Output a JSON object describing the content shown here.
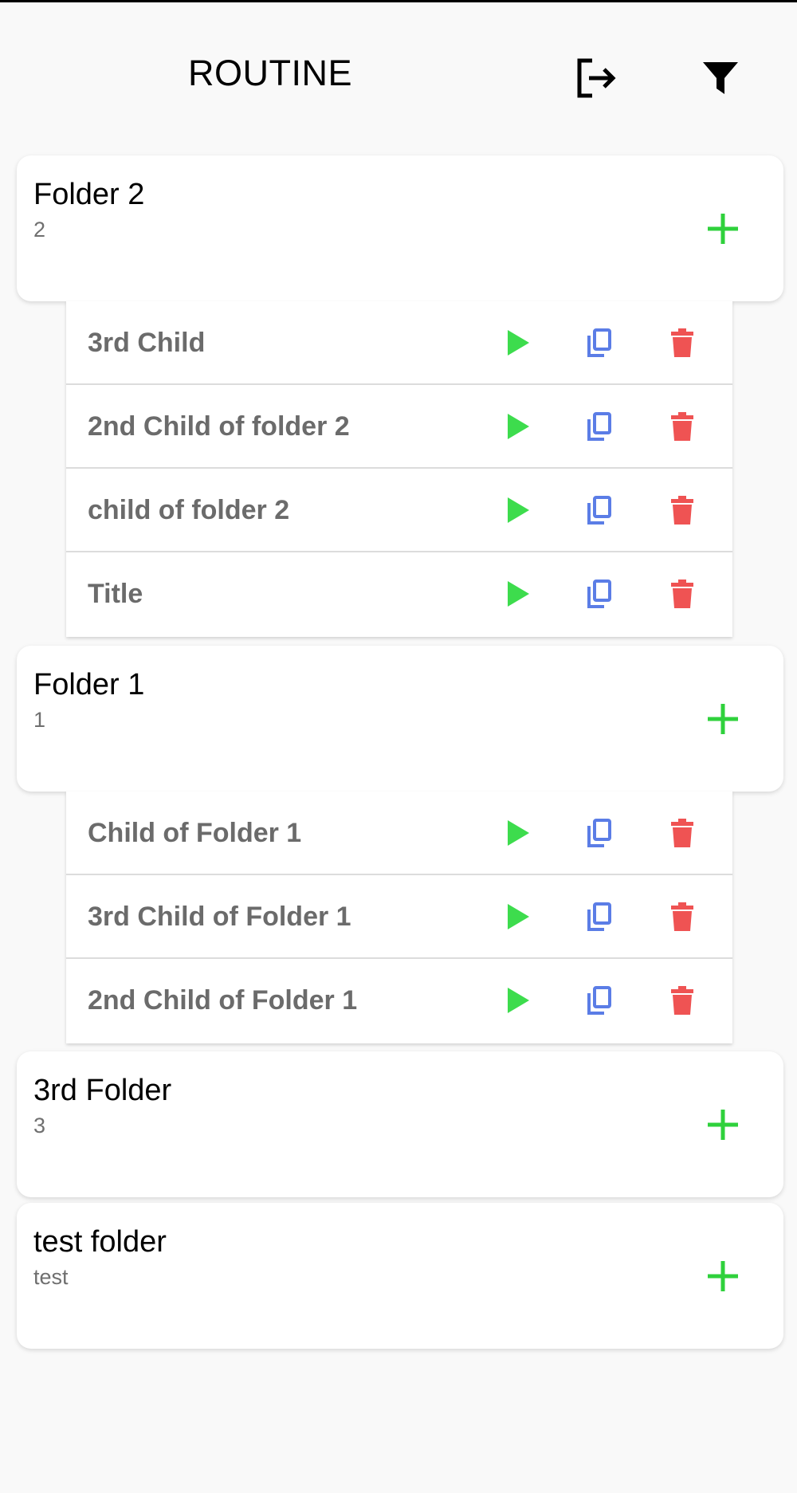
{
  "header": {
    "title": "ROUTINE",
    "logout_icon": "logout-icon",
    "filter_icon": "filter-icon"
  },
  "colors": {
    "play": "#3ddc4d",
    "copy": "#5b7de6",
    "delete": "#ef5353",
    "add": "#2fd13c"
  },
  "folders": [
    {
      "name": "Folder 2",
      "description": "2",
      "children": [
        {
          "title": "3rd Child"
        },
        {
          "title": "2nd Child of folder 2"
        },
        {
          "title": "child of folder 2"
        },
        {
          "title": "Title"
        }
      ]
    },
    {
      "name": "Folder 1",
      "description": "1",
      "children": [
        {
          "title": "Child of Folder 1"
        },
        {
          "title": "3rd Child of Folder 1"
        },
        {
          "title": "2nd Child of Folder 1"
        }
      ]
    },
    {
      "name": "3rd Folder",
      "description": "3",
      "children": []
    },
    {
      "name": "test folder",
      "description": "test",
      "children": []
    }
  ]
}
